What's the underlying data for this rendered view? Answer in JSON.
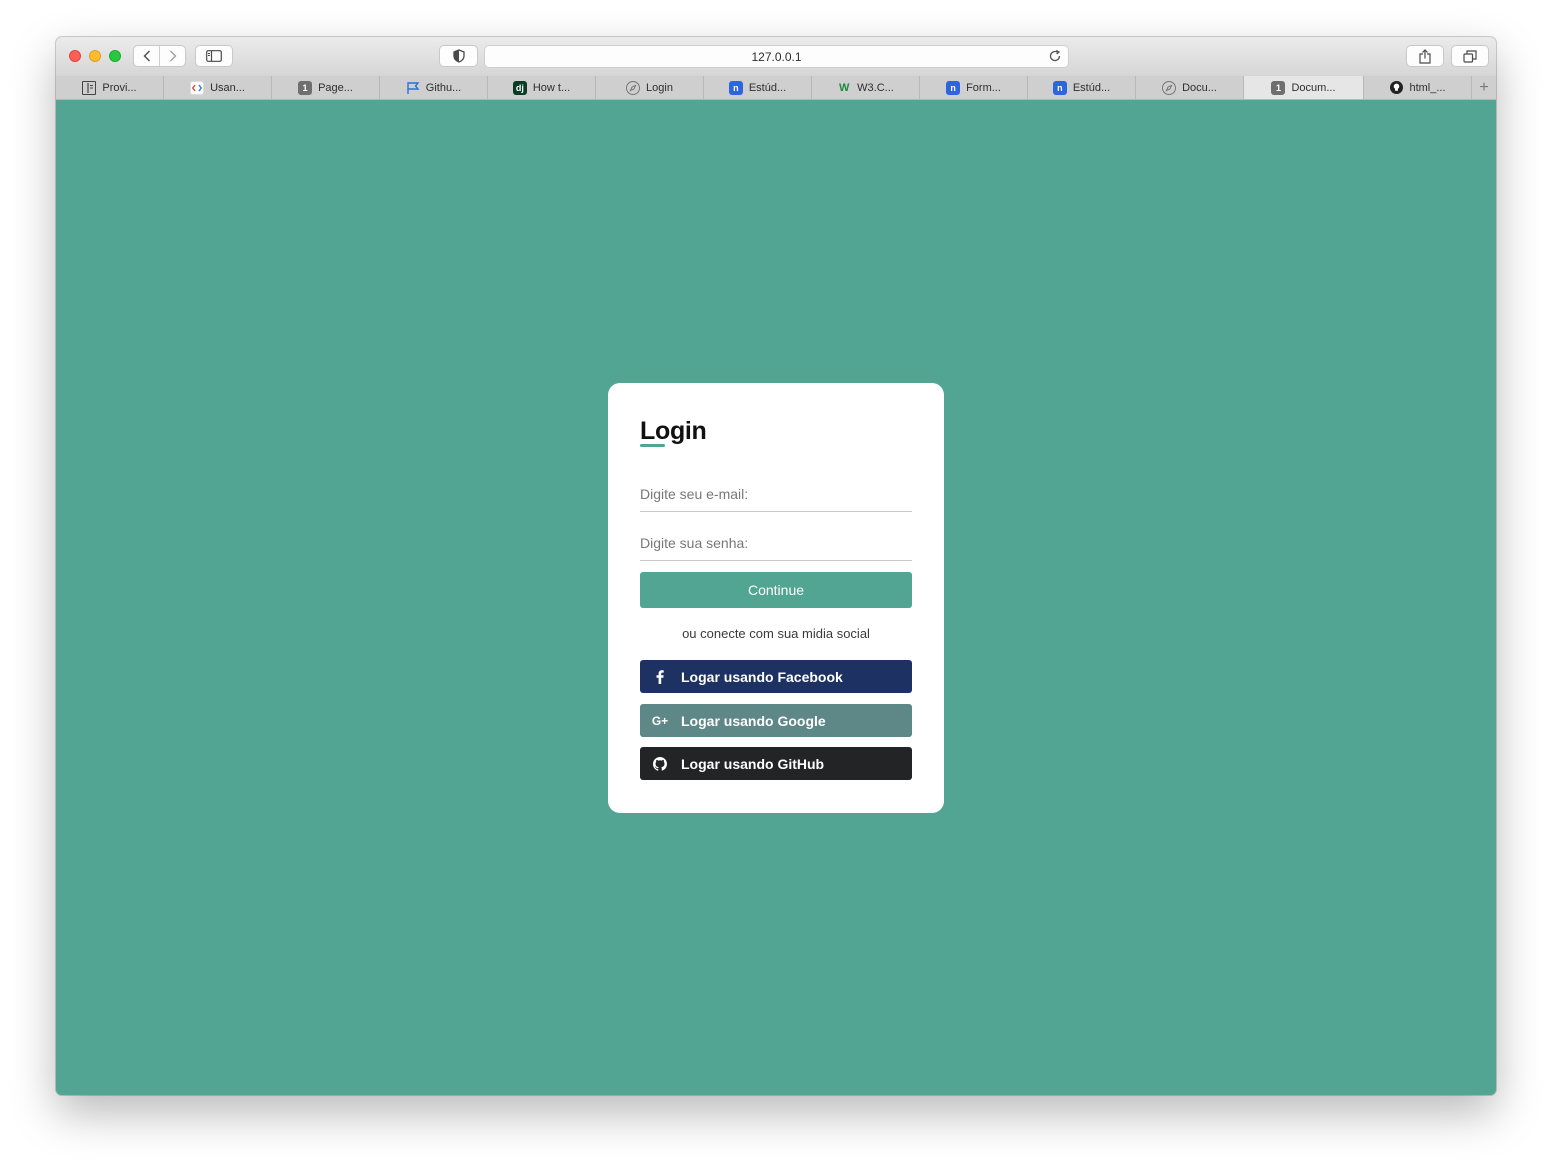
{
  "browser": {
    "url": "127.0.0.1",
    "tabs": [
      {
        "label": "Provi...",
        "icon": "book-icon",
        "color": "#444444"
      },
      {
        "label": "Usan...",
        "icon": "code-icon",
        "color": "#ffffff"
      },
      {
        "label": "Page...",
        "icon": "number-one-icon",
        "color": "#6f6f6f",
        "glyph": "1"
      },
      {
        "label": "Githu...",
        "icon": "flag-icon",
        "color": "#2f6fd6"
      },
      {
        "label": "How t...",
        "icon": "django-icon",
        "color": "#0c3c26",
        "glyph": "dj"
      },
      {
        "label": "Login",
        "icon": "compass-icon",
        "color": "#777777"
      },
      {
        "label": "Estúd...",
        "icon": "n-icon",
        "color": "#2f64e0",
        "glyph": "n"
      },
      {
        "label": "W3.C...",
        "icon": "w3-icon",
        "color": "#1d8a3a",
        "glyph": "W"
      },
      {
        "label": "Form...",
        "icon": "n-icon",
        "color": "#2f64e0",
        "glyph": "n"
      },
      {
        "label": "Estúd...",
        "icon": "n-icon",
        "color": "#2f64e0",
        "glyph": "n"
      },
      {
        "label": "Docu...",
        "icon": "compass-icon",
        "color": "#777777"
      },
      {
        "label": "Docum...",
        "icon": "number-one-icon",
        "color": "#6f6f6f",
        "glyph": "1",
        "active": true
      },
      {
        "label": "html_...",
        "icon": "github-icon",
        "color": "#222222"
      }
    ],
    "new_tab": "+"
  },
  "login": {
    "title": "Login",
    "email_placeholder": "Digite seu e-mail:",
    "password_placeholder": "Digite sua senha:",
    "continue_label": "Continue",
    "social_text": "ou conecte com sua midia social",
    "facebook_label": "Logar usando Facebook",
    "google_label": "Logar usando Google",
    "github_label": "Logar usando GitHub",
    "google_icon_text": "G+"
  },
  "colors": {
    "accent": "#51a592",
    "facebook": "#1d3263",
    "google": "#5e8887",
    "github": "#232426"
  }
}
